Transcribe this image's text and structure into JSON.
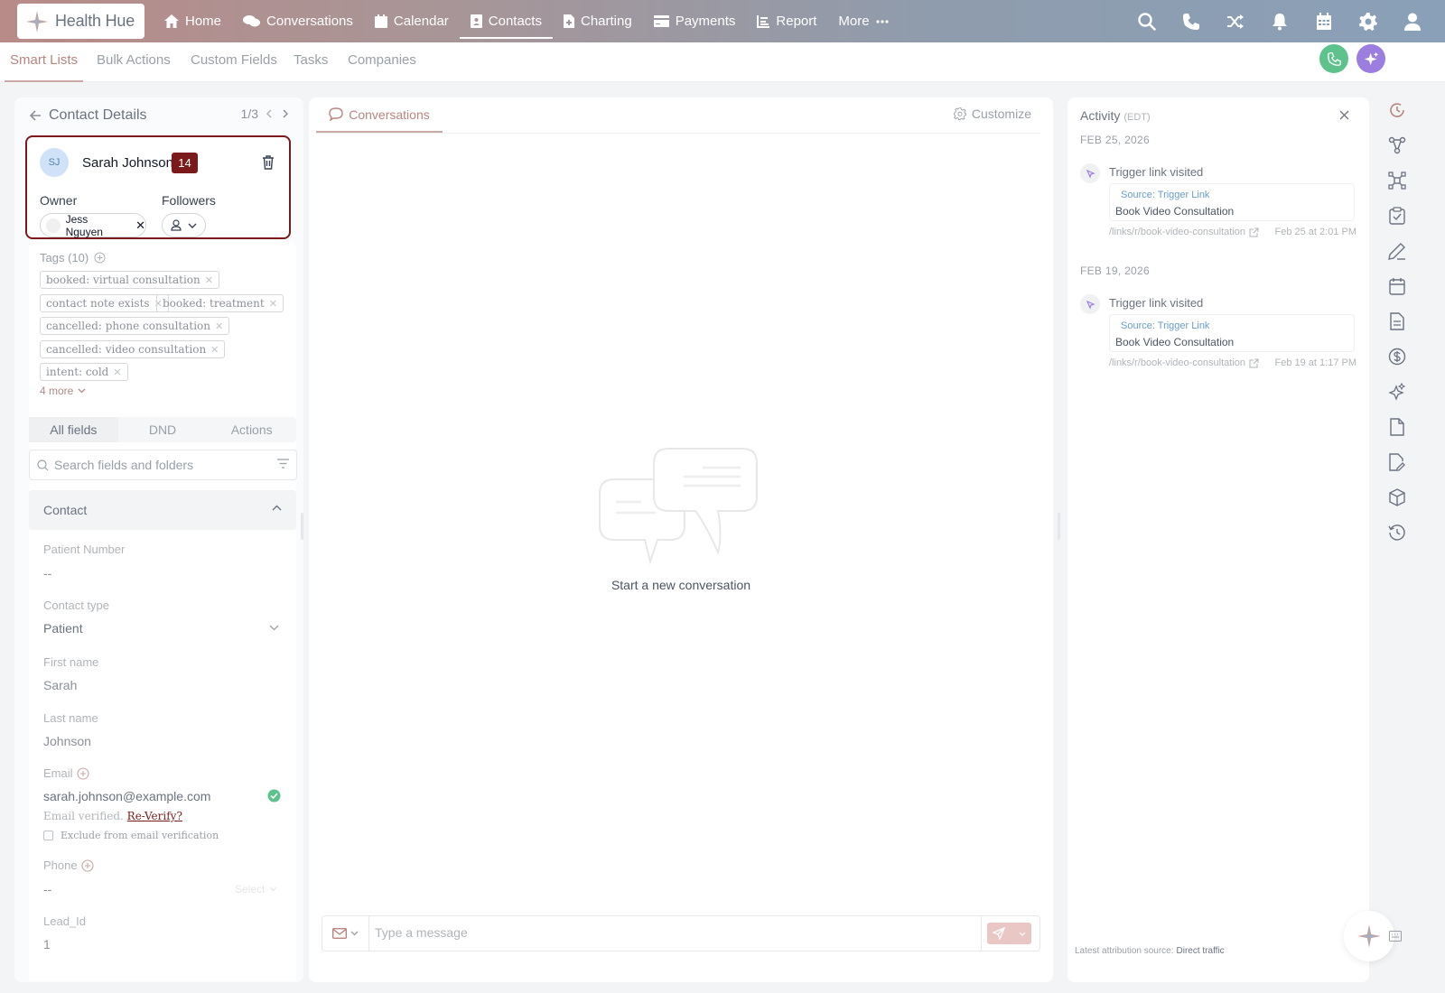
{
  "brand": {
    "name": "Health Hue"
  },
  "nav": {
    "items": [
      {
        "label": "Home",
        "icon": "home-icon"
      },
      {
        "label": "Conversations",
        "icon": "chat-bubbles-icon"
      },
      {
        "label": "Calendar",
        "icon": "calendar-icon"
      },
      {
        "label": "Contacts",
        "icon": "contact-card-icon",
        "active": true
      },
      {
        "label": "Charting",
        "icon": "document-icon"
      },
      {
        "label": "Payments",
        "icon": "credit-card-icon"
      },
      {
        "label": "Report",
        "icon": "report-icon"
      },
      {
        "label": "More",
        "icon": "ellipsis-icon"
      }
    ],
    "right_icons": [
      "search-icon",
      "phone-icon",
      "shuffle-icon",
      "bell-icon",
      "calendar-grid-icon",
      "gear-icon",
      "user-icon"
    ]
  },
  "subnav": {
    "tabs": [
      "Smart Lists",
      "Bulk Actions",
      "Custom Fields",
      "Tasks",
      "Companies"
    ],
    "active": "Smart Lists"
  },
  "colors": {
    "accent": "#b98580",
    "badge": "#7b1a1a",
    "call": "#5dc28c",
    "ai": "#9b7ee0"
  },
  "contact_details": {
    "title": "Contact Details",
    "pager": "1/3",
    "contact": {
      "initials": "SJ",
      "name": "Sarah Johnson",
      "badge": "14",
      "owner_label": "Owner",
      "followers_label": "Followers",
      "owner": "Jess Nguyen"
    },
    "tags": {
      "title": "Tags (10)",
      "items": [
        "booked: virtual consultation",
        "contact note exists",
        "booked: treatment",
        "cancelled: phone consultation",
        "cancelled: video consultation",
        "intent: cold"
      ],
      "more": "4 more"
    },
    "field_tabs": [
      "All fields",
      "DND",
      "Actions"
    ],
    "search_placeholder": "Search fields and folders",
    "section": "Contact",
    "fields": {
      "patient_number": {
        "label": "Patient Number",
        "value": "--"
      },
      "contact_type": {
        "label": "Contact type",
        "value": "Patient"
      },
      "first_name": {
        "label": "First name",
        "value": "Sarah"
      },
      "last_name": {
        "label": "Last name",
        "value": "Johnson"
      },
      "email": {
        "label": "Email",
        "value": "sarah.johnson@example.com",
        "verified_text": "Email verified.",
        "reverify": "Re-Verify?",
        "exclude": "Exclude from email verification"
      },
      "phone": {
        "label": "Phone",
        "value": "--",
        "select": "Select"
      },
      "lead_id": {
        "label": "Lead_Id",
        "value": "1"
      }
    }
  },
  "conversation": {
    "tab": "Conversations",
    "customize": "Customize",
    "empty_text": "Start a new conversation",
    "input_placeholder": "Type a message"
  },
  "activity": {
    "title": "Activity",
    "tz": "(EDT)",
    "groups": [
      {
        "date": "FEB 25, 2026",
        "event": "Trigger link visited",
        "source": "Source: Trigger Link",
        "name": "Book Video Consultation",
        "link": "/links/r/book-video-consultation",
        "time": "Feb 25 at 2:01 PM"
      },
      {
        "date": "FEB 19, 2026",
        "event": "Trigger link visited",
        "source": "Source: Trigger Link",
        "name": "Book Video Consultation",
        "link": "/links/r/book-video-consultation",
        "time": "Feb 19 at 1:17 PM"
      }
    ],
    "attribution_label": "Latest attribution source:",
    "attribution_value": "Direct traffic"
  },
  "right_rail": [
    "activity-clock-icon",
    "workflow-icon",
    "network-icon",
    "clipboard-check-icon",
    "pencil-icon",
    "calendar-icon",
    "notes-icon",
    "dollar-icon",
    "sparkle-icon",
    "file-icon",
    "file-edit-icon",
    "box-icon",
    "history-icon"
  ]
}
